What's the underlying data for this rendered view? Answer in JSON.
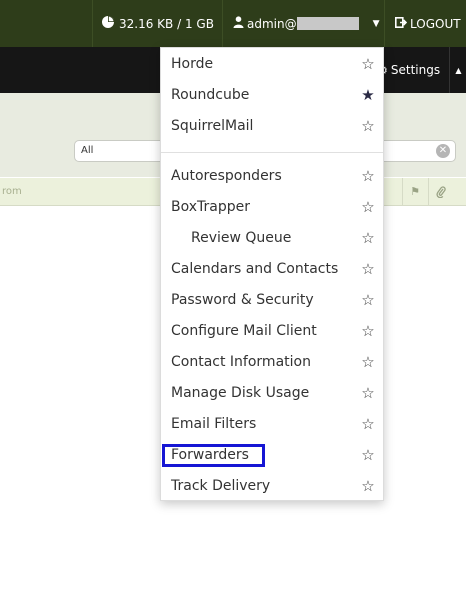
{
  "topbar": {
    "quota": "32.16 KB / 1 GB",
    "quota_icon": "pie-chart-icon",
    "user_label": "admin@",
    "user_icon": "user-icon",
    "logout_label": "LOGOUT",
    "logout_icon": "logout-icon"
  },
  "toolbar": {
    "settings_label": "Settings"
  },
  "filter": {
    "value": "All"
  },
  "list_header": {
    "from_label": "rom"
  },
  "menu": {
    "items": [
      {
        "label": "Horde",
        "favorite": false
      },
      {
        "label": "Roundcube",
        "favorite": true
      },
      {
        "label": "SquirrelMail",
        "favorite": false
      },
      {
        "label": "Autoresponders",
        "favorite": false
      },
      {
        "label": "BoxTrapper",
        "favorite": false
      },
      {
        "label": "Review Queue",
        "favorite": false
      },
      {
        "label": "Calendars and Contacts",
        "favorite": false
      },
      {
        "label": "Password & Security",
        "favorite": false
      },
      {
        "label": "Configure Mail Client",
        "favorite": false
      },
      {
        "label": "Contact Information",
        "favorite": false
      },
      {
        "label": "Manage Disk Usage",
        "favorite": false
      },
      {
        "label": "Email Filters",
        "favorite": false
      },
      {
        "label": "Forwarders",
        "favorite": false
      },
      {
        "label": "Track Delivery",
        "favorite": false
      }
    ]
  },
  "colors": {
    "topbar_bg": "#2e3d1a",
    "toolbar_bg": "#161616",
    "highlight_border": "#1616d4"
  }
}
